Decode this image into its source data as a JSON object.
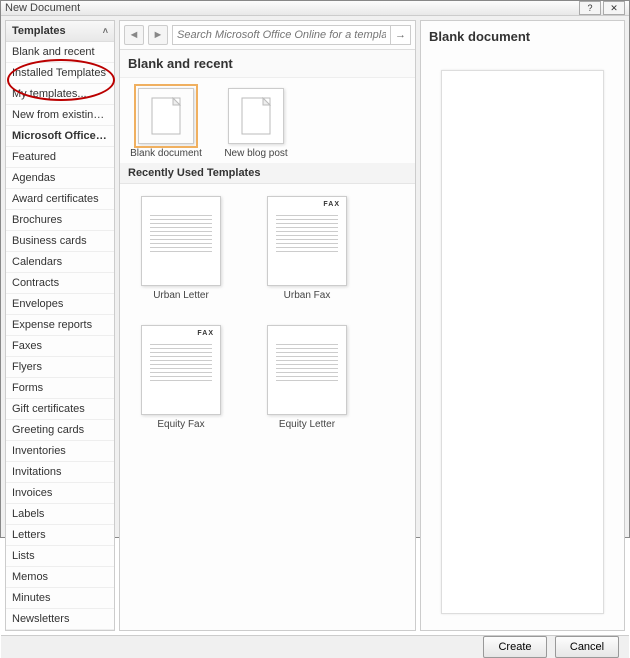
{
  "window": {
    "title": "New Document"
  },
  "sidebar": {
    "header": "Templates",
    "items": [
      "Blank and recent",
      "Installed Templates",
      "My templates...",
      "New from existing...",
      "Microsoft Office Online",
      "Featured",
      "Agendas",
      "Award certificates",
      "Brochures",
      "Business cards",
      "Calendars",
      "Contracts",
      "Envelopes",
      "Expense reports",
      "Faxes",
      "Flyers",
      "Forms",
      "Gift certificates",
      "Greeting cards",
      "Inventories",
      "Invitations",
      "Invoices",
      "Labels",
      "Letters",
      "Lists",
      "Memos",
      "Minutes",
      "Newsletters"
    ],
    "selected_index": 4
  },
  "search": {
    "placeholder": "Search Microsoft Office Online for a template"
  },
  "main": {
    "heading": "Blank and recent",
    "blank_templates": [
      {
        "label": "Blank document",
        "icon": "page"
      },
      {
        "label": "New blog post",
        "icon": "page-globe"
      }
    ],
    "recent_heading": "Recently Used Templates",
    "recent": [
      {
        "label": "Urban Letter",
        "type": "letter"
      },
      {
        "label": "Urban Fax",
        "type": "fax"
      },
      {
        "label": "Equity Fax",
        "type": "fax"
      },
      {
        "label": "Equity Letter",
        "type": "letter"
      }
    ]
  },
  "preview": {
    "title": "Blank document"
  },
  "footer": {
    "create": "Create",
    "cancel": "Cancel"
  }
}
